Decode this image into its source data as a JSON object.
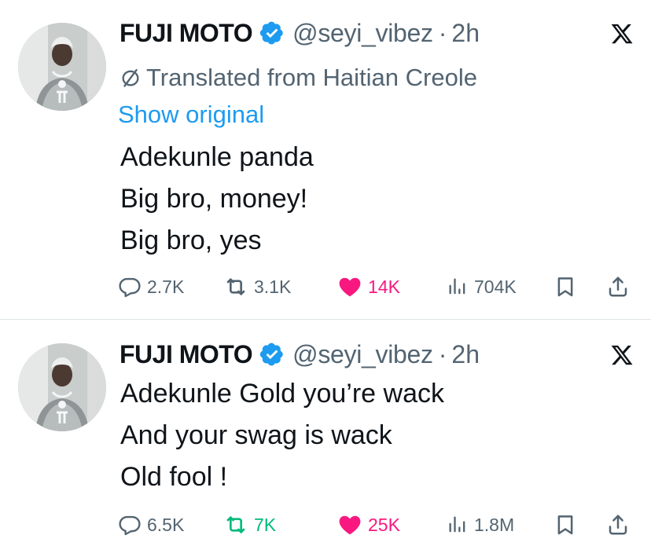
{
  "colors": {
    "text": "#0f1419",
    "secondary": "#536471",
    "link": "#1d9bf0",
    "like": "#f91880",
    "repost": "#00ba7c",
    "verified": "#1d9bf0"
  },
  "tweets": [
    {
      "author_name": "FUJI MOTO",
      "handle": "@seyi_vibez",
      "separator": "·",
      "time": "2h",
      "translated_label": "Translated from Haitian Creole",
      "show_original_label": "Show original",
      "lines": [
        "Adekunle panda",
        "Big bro, money!",
        "Big bro, yes"
      ],
      "replies": "2.7K",
      "reposts": "3.1K",
      "likes": "14K",
      "views": "704K",
      "liked": true,
      "reposted": false,
      "icons": [
        "verified-badge-icon",
        "x-logo-icon",
        "translate-icon",
        "reply-icon",
        "repost-icon",
        "like-icon",
        "views-icon",
        "bookmark-icon",
        "share-icon"
      ]
    },
    {
      "author_name": "FUJI MOTO",
      "handle": "@seyi_vibez",
      "separator": "·",
      "time": "2h",
      "lines": [
        "Adekunle Gold you’re wack",
        "And your swag is wack",
        "Old fool !"
      ],
      "replies": "6.5K",
      "reposts": "7K",
      "likes": "25K",
      "views": "1.8M",
      "liked": true,
      "reposted": true,
      "icons": [
        "verified-badge-icon",
        "x-logo-icon",
        "reply-icon",
        "repost-icon",
        "like-icon",
        "views-icon",
        "bookmark-icon",
        "share-icon"
      ]
    }
  ]
}
